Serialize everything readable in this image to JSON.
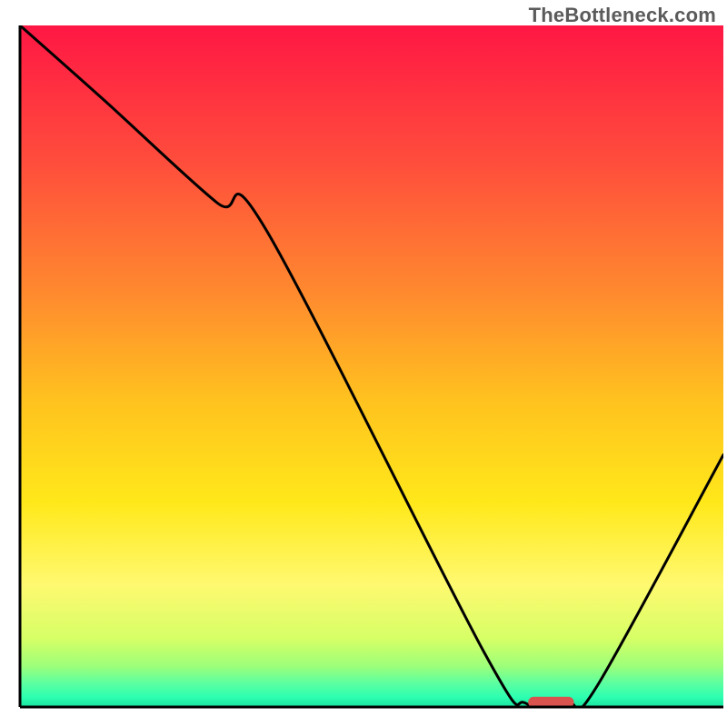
{
  "watermark": "TheBottleneck.com",
  "chart_data": {
    "type": "line",
    "title": "",
    "xlabel": "",
    "ylabel": "",
    "xlim": [
      0,
      100
    ],
    "ylim": [
      0,
      100
    ],
    "grid": false,
    "legend": false,
    "gradient_stops": [
      {
        "offset": 0.0,
        "color": "#ff1744"
      },
      {
        "offset": 0.2,
        "color": "#ff4d3c"
      },
      {
        "offset": 0.4,
        "color": "#ff8c2e"
      },
      {
        "offset": 0.55,
        "color": "#ffc21f"
      },
      {
        "offset": 0.7,
        "color": "#ffe81a"
      },
      {
        "offset": 0.82,
        "color": "#fff970"
      },
      {
        "offset": 0.9,
        "color": "#d6ff66"
      },
      {
        "offset": 0.94,
        "color": "#9dff7a"
      },
      {
        "offset": 0.965,
        "color": "#5cffa0"
      },
      {
        "offset": 0.985,
        "color": "#2effb0"
      },
      {
        "offset": 1.0,
        "color": "#18e3a1"
      }
    ],
    "series": [
      {
        "name": "bottleneck-curve",
        "color": "#000000",
        "x": [
          0,
          12,
          28,
          35,
          66,
          72,
          78,
          82,
          100
        ],
        "y": [
          100,
          89,
          74,
          70,
          8,
          0.5,
          0.5,
          3,
          37
        ]
      }
    ],
    "marker": {
      "name": "target-pill",
      "shape": "pill",
      "x": 75.5,
      "y": 0.7,
      "width": 6.5,
      "height": 1.6,
      "color": "#d9534f"
    },
    "axes": {
      "left": {
        "visible": true,
        "color": "#000000",
        "width": 3
      },
      "bottom": {
        "visible": true,
        "color": "#000000",
        "width": 3
      },
      "right": {
        "visible": false
      },
      "top": {
        "visible": false
      }
    }
  }
}
